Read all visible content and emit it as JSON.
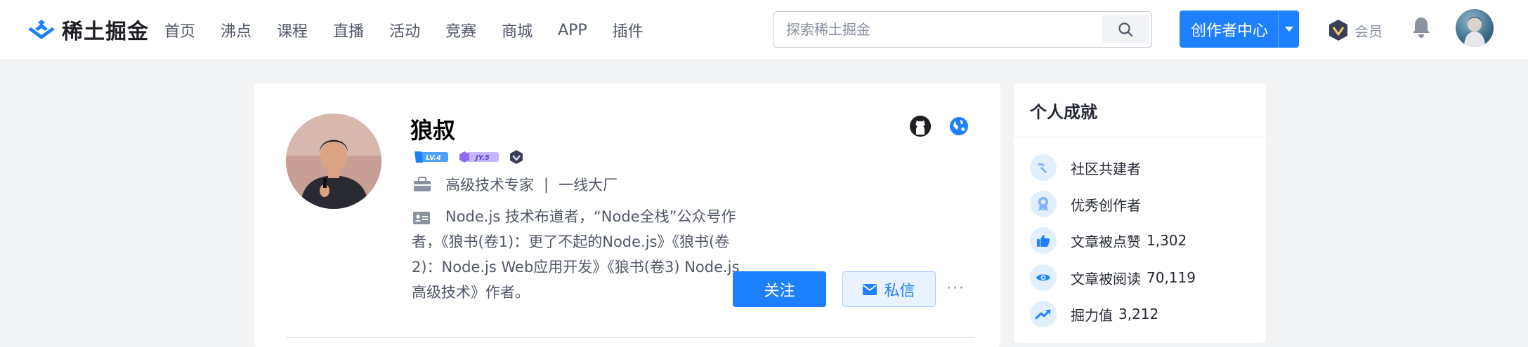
{
  "header": {
    "logo_text": "稀土掘金",
    "nav": [
      "首页",
      "沸点",
      "课程",
      "直播",
      "活动",
      "竞赛",
      "商城",
      "APP",
      "插件"
    ],
    "search_placeholder": "探索稀土掘金",
    "creator_label": "创作者中心",
    "vip_label": "会员"
  },
  "profile": {
    "name": "狼叔",
    "level_badge": "LV.4",
    "jy_badge": "JY.5",
    "job_title": "高级技术专家",
    "job_separator": "|",
    "company": "一线大厂",
    "bio": "Node.js 技术布道者，“Node全栈”公众号作者，《狼书(卷1)：更了不起的Node.js》《狼书(卷2)：Node.js Web应用开发》《狼书(卷3) Node.js高级技术》作者。",
    "follow_label": "关注",
    "message_label": "私信",
    "more_label": "···"
  },
  "achievements": {
    "title": "个人成就",
    "items": [
      {
        "label": "社区共建者",
        "value": "",
        "icon": "hammer-icon"
      },
      {
        "label": "优秀创作者",
        "value": "",
        "icon": "award-icon"
      },
      {
        "label": "文章被点赞",
        "value": "1,302",
        "icon": "thumbs-up-icon"
      },
      {
        "label": "文章被阅读",
        "value": "70,119",
        "icon": "eye-icon"
      },
      {
        "label": "掘力值",
        "value": "3,212",
        "icon": "trend-icon"
      }
    ]
  },
  "colors": {
    "brand": "#1e80ff",
    "page_bg": "#f2f3f5"
  }
}
